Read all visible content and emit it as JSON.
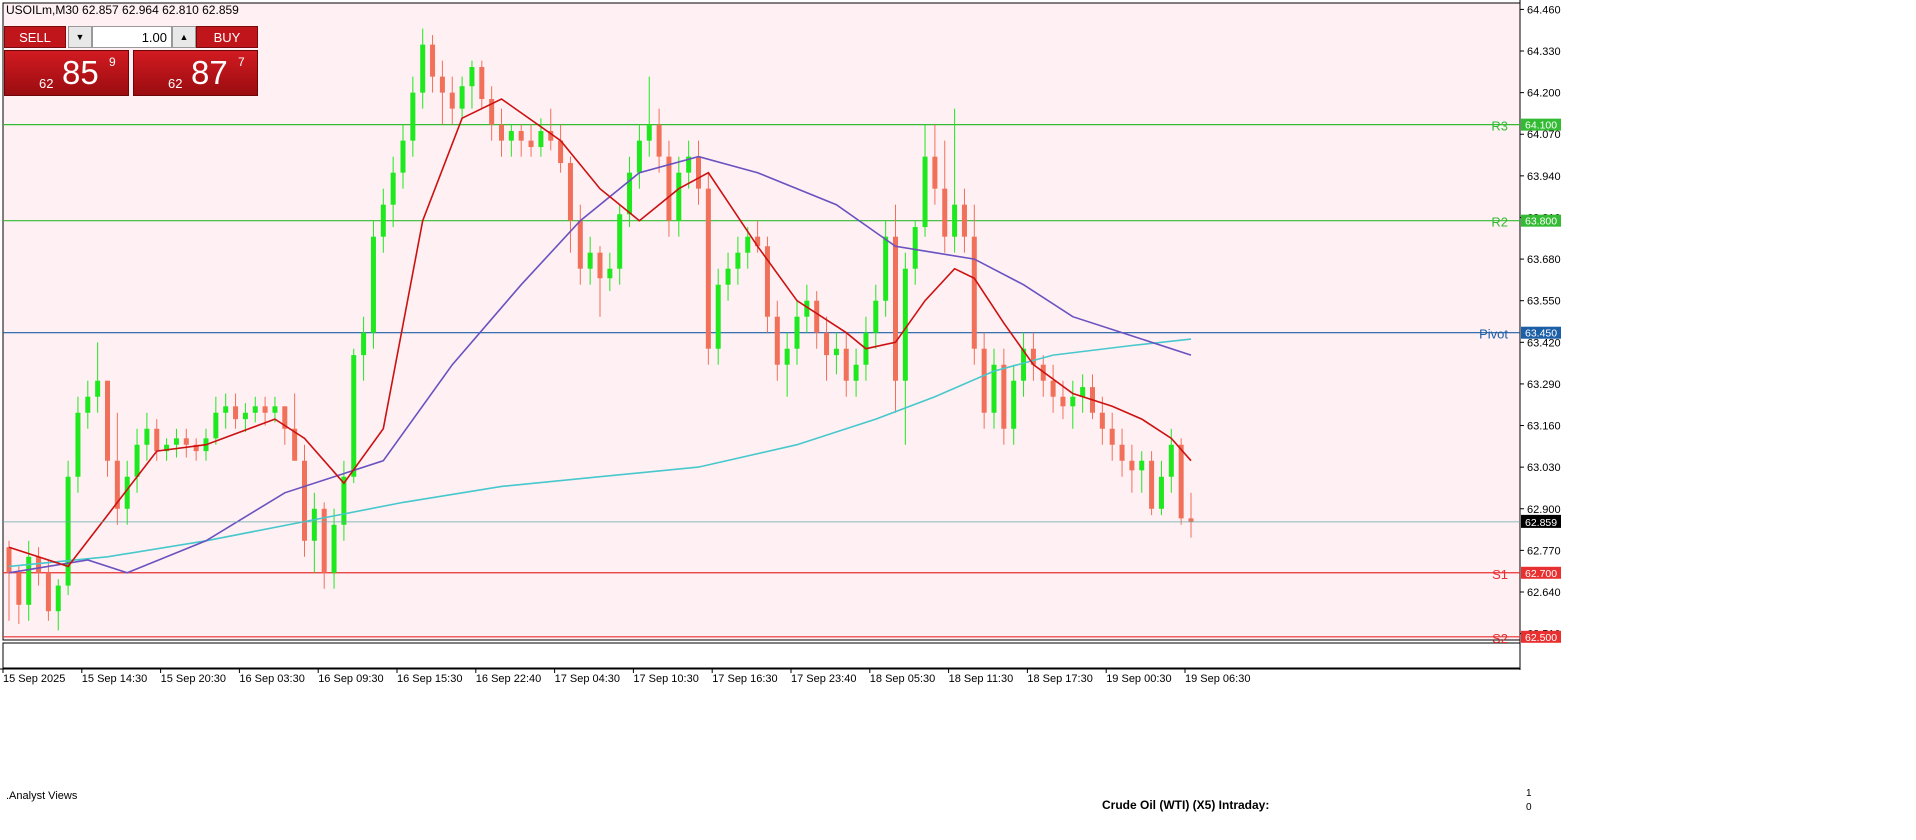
{
  "symbol_info": "USOILm,M30  62.857 62.964 62.810 62.859",
  "trade_panel": {
    "sell_label": "SELL",
    "buy_label": "BUY",
    "lot": "1.00",
    "sell_price": {
      "small": "62",
      "big": "85",
      "sup": "9"
    },
    "buy_price": {
      "small": "62",
      "big": "87",
      "sup": "7"
    }
  },
  "indicator": {
    "name": ".Analyst Views",
    "title": "Crude Oil (WTI) (X5) Intraday:",
    "scale_top": "1",
    "scale_bottom": "0"
  },
  "colors": {
    "background": "#fff0f3",
    "up": "#1ee81e",
    "down": "#f0705a",
    "ma_fast": "#cc1111",
    "ma_mid": "#6a52c0",
    "ma_slow": "#46c8cc",
    "resistance": "#33bb33",
    "pivot": "#1d5fa6",
    "support": "#e83030"
  },
  "chart_data": {
    "type": "candlestick",
    "ylim": [
      62.49,
      64.48
    ],
    "y_ticks": [
      "64.460",
      "64.330",
      "64.200",
      "64.070",
      "63.940",
      "63.810",
      "63.680",
      "63.550",
      "63.420",
      "63.290",
      "63.160",
      "63.030",
      "62.900",
      "62.770",
      "62.640",
      "62.510"
    ],
    "x_labels": [
      "15 Sep 2025",
      "15 Sep 14:30",
      "15 Sep 20:30",
      "16 Sep 03:30",
      "16 Sep 09:30",
      "16 Sep 15:30",
      "16 Sep 22:40",
      "17 Sep 04:30",
      "17 Sep 10:30",
      "17 Sep 16:30",
      "17 Sep 23:40",
      "18 Sep 05:30",
      "18 Sep 11:30",
      "18 Sep 17:30",
      "19 Sep 00:30",
      "19 Sep 06:30"
    ],
    "levels": [
      {
        "label": "R3",
        "value": 64.1,
        "price": "64.100",
        "kind": "resistance"
      },
      {
        "label": "R2",
        "value": 63.8,
        "price": "63.800",
        "kind": "resistance"
      },
      {
        "label": "Pivot",
        "value": 63.45,
        "price": "63.450",
        "kind": "pivot"
      },
      {
        "label": "S1",
        "value": 62.7,
        "price": "62.700",
        "kind": "support"
      },
      {
        "label": "S2",
        "value": 62.5,
        "price": "62.500",
        "kind": "support"
      }
    ],
    "last_price": "62.859",
    "last_value": 62.859,
    "candles": [
      [
        62.78,
        62.8,
        62.55,
        62.7
      ],
      [
        62.7,
        62.72,
        62.54,
        62.6
      ],
      [
        62.6,
        62.8,
        62.55,
        62.75
      ],
      [
        62.75,
        62.78,
        62.66,
        62.7
      ],
      [
        62.7,
        62.74,
        62.55,
        62.58
      ],
      [
        62.58,
        62.68,
        62.52,
        62.66
      ],
      [
        62.66,
        63.05,
        62.63,
        63.0
      ],
      [
        63.0,
        63.25,
        62.95,
        63.2
      ],
      [
        63.2,
        63.3,
        63.15,
        63.25
      ],
      [
        63.25,
        63.42,
        63.2,
        63.3
      ],
      [
        63.3,
        63.3,
        63.0,
        63.05
      ],
      [
        63.05,
        63.2,
        62.85,
        62.9
      ],
      [
        62.9,
        63.05,
        62.85,
        63.0
      ],
      [
        63.0,
        63.15,
        62.95,
        63.1
      ],
      [
        63.1,
        63.2,
        63.05,
        63.15
      ],
      [
        63.15,
        63.18,
        63.05,
        63.08
      ],
      [
        63.08,
        63.12,
        63.05,
        63.1
      ],
      [
        63.1,
        63.15,
        63.06,
        63.12
      ],
      [
        63.12,
        63.15,
        63.06,
        63.1
      ],
      [
        63.1,
        63.12,
        63.05,
        63.08
      ],
      [
        63.08,
        63.15,
        63.05,
        63.12
      ],
      [
        63.12,
        63.25,
        63.1,
        63.2
      ],
      [
        63.2,
        63.26,
        63.15,
        63.22
      ],
      [
        63.22,
        63.26,
        63.15,
        63.18
      ],
      [
        63.18,
        63.23,
        63.14,
        63.2
      ],
      [
        63.2,
        63.25,
        63.17,
        63.22
      ],
      [
        63.22,
        63.25,
        63.16,
        63.2
      ],
      [
        63.2,
        63.25,
        63.17,
        63.22
      ],
      [
        63.22,
        63.22,
        63.1,
        63.15
      ],
      [
        63.15,
        63.26,
        63.05,
        63.05
      ],
      [
        63.05,
        63.1,
        62.75,
        62.8
      ],
      [
        62.8,
        62.95,
        62.7,
        62.9
      ],
      [
        62.9,
        62.92,
        62.65,
        62.7
      ],
      [
        62.7,
        62.9,
        62.65,
        62.85
      ],
      [
        62.85,
        63.05,
        62.8,
        63.0
      ],
      [
        63.0,
        63.4,
        62.98,
        63.38
      ],
      [
        63.38,
        63.5,
        63.3,
        63.45
      ],
      [
        63.45,
        63.8,
        63.4,
        63.75
      ],
      [
        63.75,
        63.9,
        63.7,
        63.85
      ],
      [
        63.85,
        64.0,
        63.78,
        63.95
      ],
      [
        63.95,
        64.1,
        63.9,
        64.05
      ],
      [
        64.05,
        64.25,
        64.0,
        64.2
      ],
      [
        64.2,
        64.4,
        64.15,
        64.35
      ],
      [
        64.35,
        64.38,
        64.2,
        64.25
      ],
      [
        64.25,
        64.3,
        64.1,
        64.2
      ],
      [
        64.2,
        64.25,
        64.1,
        64.15
      ],
      [
        64.15,
        64.25,
        64.12,
        64.22
      ],
      [
        64.22,
        64.3,
        64.15,
        64.28
      ],
      [
        64.28,
        64.3,
        64.15,
        64.18
      ],
      [
        64.18,
        64.22,
        64.05,
        64.1
      ],
      [
        64.1,
        64.15,
        64.0,
        64.05
      ],
      [
        64.05,
        64.1,
        64.0,
        64.08
      ],
      [
        64.08,
        64.1,
        64.0,
        64.05
      ],
      [
        64.05,
        64.1,
        64.0,
        64.03
      ],
      [
        64.03,
        64.12,
        64.0,
        64.08
      ],
      [
        64.08,
        64.15,
        64.02,
        64.05
      ],
      [
        64.05,
        64.1,
        63.95,
        63.98
      ],
      [
        63.98,
        64.0,
        63.7,
        63.8
      ],
      [
        63.8,
        63.85,
        63.6,
        63.65
      ],
      [
        63.65,
        63.75,
        63.6,
        63.7
      ],
      [
        63.7,
        63.72,
        63.5,
        63.62
      ],
      [
        63.62,
        63.7,
        63.58,
        63.65
      ],
      [
        63.65,
        63.85,
        63.6,
        63.82
      ],
      [
        63.82,
        64.0,
        63.78,
        63.95
      ],
      [
        63.95,
        64.1,
        63.9,
        64.05
      ],
      [
        64.05,
        64.25,
        64.0,
        64.1
      ],
      [
        64.1,
        64.15,
        63.95,
        64.0
      ],
      [
        64.0,
        64.05,
        63.75,
        63.8
      ],
      [
        63.8,
        64.0,
        63.75,
        63.95
      ],
      [
        63.95,
        64.05,
        63.9,
        64.0
      ],
      [
        64.0,
        64.05,
        63.85,
        63.9
      ],
      [
        63.9,
        63.95,
        63.35,
        63.4
      ],
      [
        63.4,
        63.65,
        63.35,
        63.6
      ],
      [
        63.6,
        63.7,
        63.55,
        63.65
      ],
      [
        63.65,
        63.75,
        63.6,
        63.7
      ],
      [
        63.7,
        63.78,
        63.65,
        63.75
      ],
      [
        63.75,
        63.8,
        63.7,
        63.72
      ],
      [
        63.72,
        63.75,
        63.45,
        63.5
      ],
      [
        63.5,
        63.55,
        63.3,
        63.35
      ],
      [
        63.35,
        63.45,
        63.25,
        63.4
      ],
      [
        63.4,
        63.55,
        63.35,
        63.5
      ],
      [
        63.5,
        63.6,
        63.45,
        63.55
      ],
      [
        63.55,
        63.58,
        63.4,
        63.45
      ],
      [
        63.45,
        63.5,
        63.3,
        63.38
      ],
      [
        63.38,
        63.45,
        63.32,
        63.4
      ],
      [
        63.4,
        63.45,
        63.25,
        63.3
      ],
      [
        63.3,
        63.4,
        63.25,
        63.35
      ],
      [
        63.35,
        63.5,
        63.3,
        63.45
      ],
      [
        63.45,
        63.6,
        63.4,
        63.55
      ],
      [
        63.55,
        63.8,
        63.5,
        63.75
      ],
      [
        63.75,
        63.85,
        63.2,
        63.3
      ],
      [
        63.3,
        63.7,
        63.1,
        63.65
      ],
      [
        63.65,
        63.8,
        63.6,
        63.78
      ],
      [
        63.78,
        64.1,
        63.75,
        64.0
      ],
      [
        64.0,
        64.1,
        63.85,
        63.9
      ],
      [
        63.9,
        64.05,
        63.7,
        63.75
      ],
      [
        63.75,
        64.15,
        63.7,
        63.85
      ],
      [
        63.85,
        63.9,
        63.7,
        63.75
      ],
      [
        63.75,
        63.85,
        63.35,
        63.4
      ],
      [
        63.4,
        63.45,
        63.15,
        63.2
      ],
      [
        63.2,
        63.4,
        63.15,
        63.35
      ],
      [
        63.35,
        63.4,
        63.1,
        63.15
      ],
      [
        63.15,
        63.35,
        63.1,
        63.3
      ],
      [
        63.3,
        63.45,
        63.25,
        63.4
      ],
      [
        63.4,
        63.45,
        63.3,
        63.35
      ],
      [
        63.35,
        63.38,
        63.25,
        63.3
      ],
      [
        63.3,
        63.35,
        63.2,
        63.25
      ],
      [
        63.25,
        63.3,
        63.18,
        63.22
      ],
      [
        63.22,
        63.3,
        63.15,
        63.25
      ],
      [
        63.25,
        63.32,
        63.2,
        63.28
      ],
      [
        63.28,
        63.32,
        63.18,
        63.2
      ],
      [
        63.2,
        63.25,
        63.1,
        63.15
      ],
      [
        63.15,
        63.2,
        63.05,
        63.1
      ],
      [
        63.1,
        63.15,
        63.0,
        63.05
      ],
      [
        63.05,
        63.1,
        62.95,
        63.02
      ],
      [
        63.02,
        63.08,
        62.95,
        63.05
      ],
      [
        63.05,
        63.08,
        62.88,
        62.9
      ],
      [
        62.9,
        63.05,
        62.88,
        63.0
      ],
      [
        63.0,
        63.15,
        62.95,
        63.1
      ],
      [
        63.1,
        63.12,
        62.85,
        62.87
      ],
      [
        62.87,
        62.95,
        62.81,
        62.86
      ]
    ],
    "ma_fast": [
      [
        0,
        62.78
      ],
      [
        6,
        62.72
      ],
      [
        10,
        62.88
      ],
      [
        15,
        63.08
      ],
      [
        20,
        63.1
      ],
      [
        27,
        63.18
      ],
      [
        30,
        63.12
      ],
      [
        34,
        62.98
      ],
      [
        38,
        63.15
      ],
      [
        42,
        63.8
      ],
      [
        46,
        64.12
      ],
      [
        50,
        64.18
      ],
      [
        56,
        64.05
      ],
      [
        60,
        63.9
      ],
      [
        64,
        63.8
      ],
      [
        68,
        63.9
      ],
      [
        71,
        63.95
      ],
      [
        76,
        63.72
      ],
      [
        80,
        63.55
      ],
      [
        85,
        63.45
      ],
      [
        87,
        63.4
      ],
      [
        90,
        63.42
      ],
      [
        93,
        63.55
      ],
      [
        96,
        63.65
      ],
      [
        98,
        63.62
      ],
      [
        101,
        63.48
      ],
      [
        104,
        63.35
      ],
      [
        108,
        63.26
      ],
      [
        112,
        63.22
      ],
      [
        115,
        63.18
      ],
      [
        118,
        63.12
      ],
      [
        120,
        63.05
      ]
    ],
    "ma_mid": [
      [
        0,
        62.7
      ],
      [
        8,
        62.74
      ],
      [
        12,
        62.7
      ],
      [
        20,
        62.8
      ],
      [
        28,
        62.95
      ],
      [
        33,
        63.0
      ],
      [
        38,
        63.05
      ],
      [
        45,
        63.35
      ],
      [
        52,
        63.6
      ],
      [
        58,
        63.8
      ],
      [
        64,
        63.95
      ],
      [
        70,
        64.0
      ],
      [
        76,
        63.95
      ],
      [
        84,
        63.85
      ],
      [
        90,
        63.72
      ],
      [
        94,
        63.7
      ],
      [
        98,
        63.68
      ],
      [
        103,
        63.6
      ],
      [
        108,
        63.5
      ],
      [
        114,
        63.44
      ],
      [
        120,
        63.38
      ]
    ],
    "ma_slow": [
      [
        0,
        62.72
      ],
      [
        10,
        62.75
      ],
      [
        20,
        62.8
      ],
      [
        30,
        62.86
      ],
      [
        40,
        62.92
      ],
      [
        50,
        62.97
      ],
      [
        60,
        63.0
      ],
      [
        70,
        63.03
      ],
      [
        80,
        63.1
      ],
      [
        88,
        63.18
      ],
      [
        94,
        63.25
      ],
      [
        100,
        63.33
      ],
      [
        106,
        63.38
      ],
      [
        114,
        63.41
      ],
      [
        120,
        63.43
      ]
    ]
  }
}
